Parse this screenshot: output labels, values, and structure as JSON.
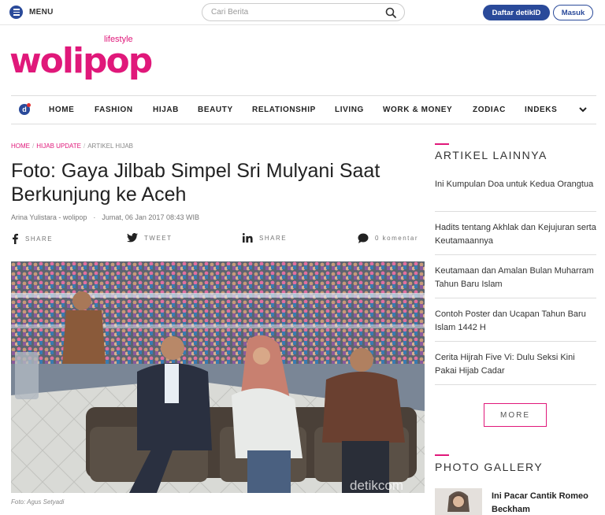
{
  "header": {
    "menu_label": "MENU",
    "search_placeholder": "Cari Berita",
    "register_label": "Daftar detikID",
    "login_label": "Masuk"
  },
  "logo": {
    "main": "wolipop",
    "sub": "lifestyle"
  },
  "nav": {
    "items": [
      "HOME",
      "FASHION",
      "HIJAB",
      "BEAUTY",
      "RELATIONSHIP",
      "LIVING",
      "WORK & MONEY",
      "ZODIAC",
      "INDEKS"
    ]
  },
  "breadcrumb": [
    "HOME",
    "HIJAB UPDATE",
    "ARTIKEL HIJAB"
  ],
  "article": {
    "title": "Foto: Gaya Jilbab Simpel Sri Mulyani Saat Berkunjung ke Aceh",
    "author": "Arina Yulistara - wolipop",
    "date": "Jumat, 06 Jan 2017 08:43 WIB",
    "share_facebook": "SHARE",
    "share_twitter": "TWEET",
    "share_linkedin": "SHARE",
    "comments": "0 komentar",
    "photo_watermark": "detikcom",
    "caption": "Foto: Agus Setyadi"
  },
  "sidebar": {
    "other_articles_title": "ARTIKEL LAINNYA",
    "articles": [
      "Ini Kumpulan Doa untuk Kedua Orangtua",
      "Hadits tentang Akhlak dan Kejujuran serta Keutamaannya",
      "Keutamaan dan Amalan Bulan Muharram Tahun Baru Islam",
      "Contoh Poster dan Ucapan Tahun Baru Islam 1442 H",
      "Cerita Hijrah Five Vi: Dulu Seksi Kini Pakai Hijab Cadar"
    ],
    "more_label": "MORE",
    "gallery_title": "PHOTO GALLERY",
    "gallery_item": "Ini Pacar Cantik Romeo Beckham"
  },
  "colors": {
    "brand": "#e0187a",
    "detik_blue": "#2a4a9a"
  }
}
